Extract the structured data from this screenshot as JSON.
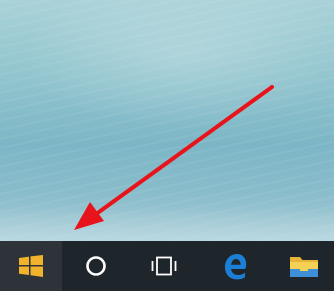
{
  "desktop": {
    "wallpaper": "ocean-shore"
  },
  "annotation": {
    "type": "arrow",
    "color": "#e8141b",
    "points_to": "start-button"
  },
  "taskbar": {
    "background": "#1f262b",
    "buttons": [
      {
        "id": "start",
        "icon": "windows-logo-icon",
        "color": "#f1b22c"
      },
      {
        "id": "search",
        "icon": "cortana-circle-icon",
        "color": "#ffffff"
      },
      {
        "id": "task_view",
        "icon": "task-view-icon",
        "color": "#ffffff"
      },
      {
        "id": "edge",
        "icon": "edge-browser-icon",
        "color": "#1c7fd6"
      },
      {
        "id": "file_explorer",
        "icon": "folder-icon",
        "color": "#f3c64a"
      }
    ]
  }
}
